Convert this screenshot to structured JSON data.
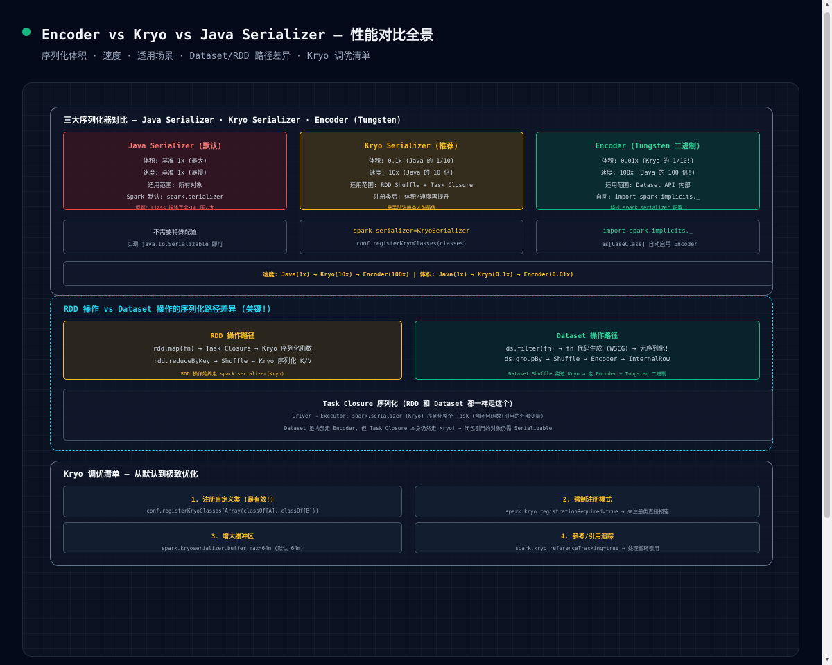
{
  "header": {
    "title": "Encoder vs Kryo vs Java Serializer — 性能对比全景",
    "subtitle": "序列化体积 · 速度 · 适用场景 · Dataset/RDD 路径差异 · Kryo 调优清单"
  },
  "section_compare": {
    "title": "三大序列化器对比 — Java Serializer · Kryo Serializer · Encoder (Tungsten)",
    "java": {
      "title": "Java Serializer (默认)",
      "lines": [
        "体积: 基准 1x (最大)",
        "速度: 基准 1x (最慢)",
        "适用范围: 所有对象",
        "Spark 默认: spark.serializer"
      ],
      "note": "问题: Class 描述冗余·GC 压力大",
      "cfg_title": "不需要特殊配置",
      "cfg_detail": "实现 java.io.Serializable 即可"
    },
    "kryo": {
      "title": "Kryo Serializer (推荐)",
      "lines": [
        "体积: 0.1x (Java 的 1/10)",
        "速度: 10x (Java 的 10 倍)",
        "适用范围: RDD Shuffle + Task Closure",
        "注册类后: 体积/速度再提升"
      ],
      "note": "需手动注册类才能最优",
      "cfg_title": "spark.serializer=KryoSerializer",
      "cfg_detail": "conf.registerKryoClasses(classes)"
    },
    "encoder": {
      "title": "Encoder (Tungsten 二进制)",
      "lines": [
        "体积: 0.01x (Kryo 的 1/10!)",
        "速度: 100x (Java 的 100 倍!)",
        "适用范围: Dataset API 内部",
        "自动: import spark.implicits._"
      ],
      "note": "绕过 spark.serializer 配置!",
      "cfg_title": "import spark.implicits._",
      "cfg_detail": ".as[CaseClass] 自动启用 Encoder"
    },
    "summary": "速度: Java(1x) → Kryo(10x) → Encoder(100x) | 体积: Java(1x) → Kryo(0.1x) → Encoder(0.01x)"
  },
  "section_paths": {
    "title": "RDD 操作 vs Dataset 操作的序列化路径差异 (关键!)",
    "rdd": {
      "title": "RDD 操作路径",
      "lines": [
        "rdd.map(fn) → Task Closure → Kryo 序列化函数",
        "rdd.reduceByKey → Shuffle → Kryo 序列化 K/V"
      ],
      "note": "RDD 操作始终走 spark.serializer(Kryo)"
    },
    "dataset": {
      "title": "Dataset 操作路径",
      "lines": [
        "ds.filter(fn) → fn 代码生成 (WSCG) → 无序列化!",
        "ds.groupBy → Shuffle → Encoder → InternalRow"
      ],
      "note": "Dataset Shuffle 绕过 Kryo → 走 Encoder + Tungsten 二进制"
    },
    "closure": {
      "title": "Task Closure 序列化 (RDD 和 Dataset 都一样走这个)",
      "lines": [
        "Driver → Executor: spark.serializer (Kryo) 序列化整个 Task (含闭包函数+引用的外部变量)",
        "Dataset 虽内部走 Encoder, 但 Task Closure 本身仍然走 Kryo! → 闭包引用的对象仍需 Serializable"
      ]
    }
  },
  "section_tuning": {
    "title": "Kryo 调优清单 — 从默认到极致优化",
    "tips": [
      {
        "title": "1. 注册自定义类 (最有效!)",
        "detail": "conf.registerKryoClasses(Array(classOf[A], classOf[B]))"
      },
      {
        "title": "2. 强制注册模式",
        "detail": "spark.kryo.registrationRequired=true → 未注册类直接报错"
      },
      {
        "title": "3. 增大缓冲区",
        "detail": "spark.kryoserializer.buffer.max=64m (默认 64m)"
      },
      {
        "title": "4. 参考/引用追踪",
        "detail": "spark.kryo.referenceTracking=true → 处理循环引用"
      }
    ]
  },
  "colors": {
    "accent_green": "#10b981",
    "java_red": "#ef4444",
    "kryo_amber": "#fbbf24",
    "path_cyan": "#22d3ee"
  }
}
